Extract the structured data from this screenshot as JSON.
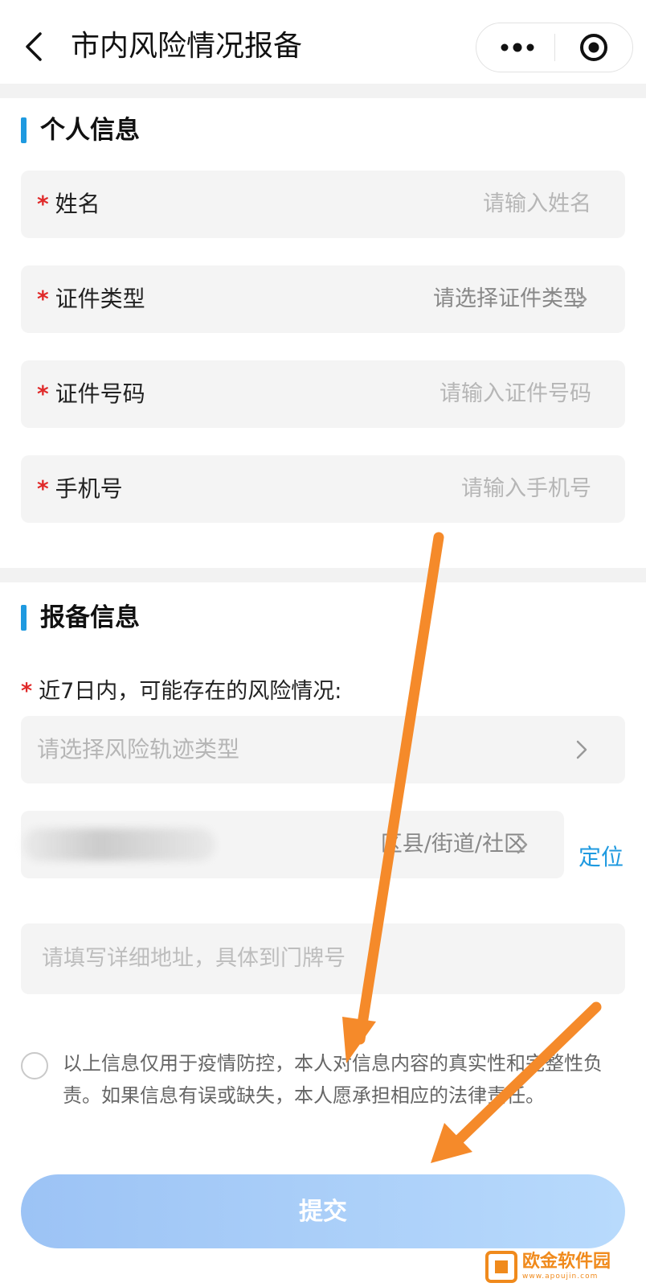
{
  "nav": {
    "back_icon": "chevron-left-icon",
    "title": "市内风险情况报备",
    "more_icon": "more-dots-icon",
    "close_icon": "target-circle-icon"
  },
  "personal": {
    "section_title": "个人信息",
    "fields": [
      {
        "label": "姓名",
        "placeholder": "请输入姓名"
      },
      {
        "label": "证件类型",
        "placeholder": "请选择证件类型"
      },
      {
        "label": "证件号码",
        "placeholder": "请输入证件号码"
      },
      {
        "label": "手机号",
        "placeholder": "请输入手机号"
      }
    ]
  },
  "report": {
    "section_title": "报备信息",
    "risk_question": "近7日内，可能存在的风险情况:",
    "risk_select_placeholder": "请选择风险轨迹类型",
    "region_placeholder": "区县/街道/社区",
    "locate_label": "定位",
    "address_placeholder": "请填写详细地址，具体到门牌号"
  },
  "agreement": {
    "text": "以上信息仅用于疫情防控，本人对信息内容的真实性和完整性负责。如果信息有误或缺失，本人愿承担相应的法律责任。"
  },
  "submit_label": "提交",
  "watermark": {
    "name": "欧金软件园",
    "url": "www.apoujin.com"
  },
  "colors": {
    "accent": "#1f9ae0",
    "required": "#e02a2a",
    "arrow": "#f58a2a",
    "submit_start": "#9cc3f5",
    "submit_end": "#b8dafc"
  }
}
